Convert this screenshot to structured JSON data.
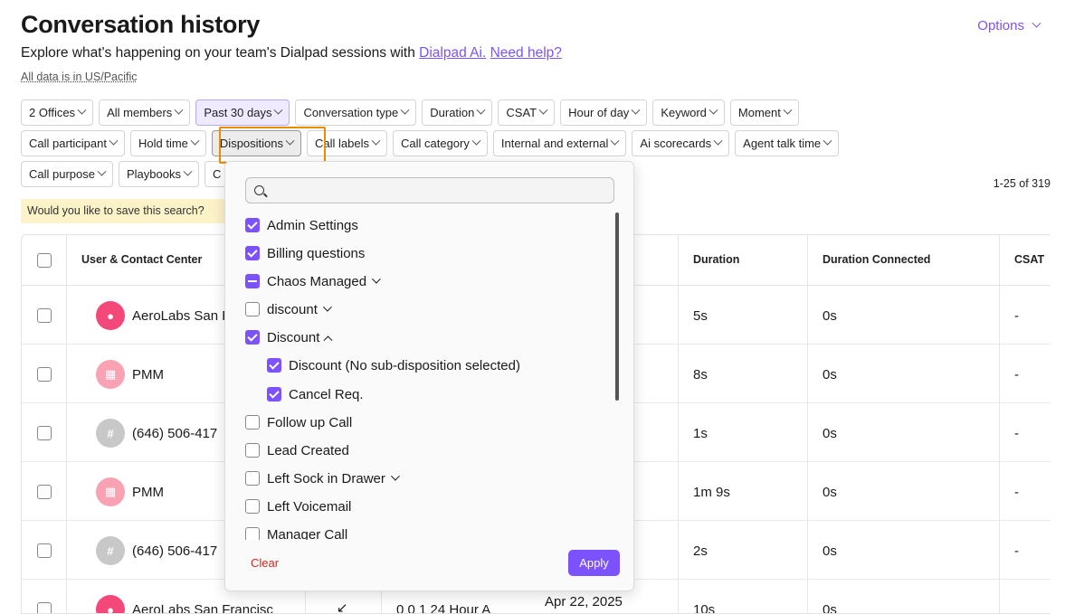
{
  "header": {
    "title": "Conversation history",
    "subtitle_text": "Explore what's happening on your team's Dialpad sessions with ",
    "subtitle_link1": "Dialpad Ai.",
    "subtitle_link2": "Need help?",
    "timezone_note": "All data is in US/Pacific",
    "options_label": "Options"
  },
  "filters": {
    "row1": [
      "2 Offices",
      "All members",
      "Past 30 days",
      "Conversation type",
      "Duration",
      "CSAT",
      "Hour of day",
      "Keyword",
      "Moment"
    ],
    "row2": [
      "Call participant",
      "Hold time",
      "Dispositions",
      "Call labels",
      "Call category",
      "Internal and external",
      "Ai scorecards",
      "Agent talk time"
    ],
    "row3": [
      "Call purpose",
      "Playbooks",
      "C"
    ]
  },
  "results_count": "1-25 of 319",
  "save_banner": "Would you like to save this search?",
  "table": {
    "headers": {
      "user": "User & Contact Center",
      "duration": "Duration",
      "duration_connected": "Duration Connected",
      "csat": "CSAT"
    },
    "rows": [
      {
        "name": "AeroLabs San Fr",
        "duration": "5s",
        "connected": "0s",
        "csat": "-"
      },
      {
        "name": "PMM",
        "duration": "8s",
        "connected": "0s",
        "csat": "-"
      },
      {
        "name": "(646) 506-417",
        "duration": "1s",
        "connected": "0s",
        "csat": "-"
      },
      {
        "name": "PMM",
        "duration": "1m 9s",
        "connected": "0s",
        "csat": "-"
      },
      {
        "name": "(646) 506-417",
        "duration": "2s",
        "connected": "0s",
        "csat": "-"
      },
      {
        "name": "AeroLabs San Francisc",
        "duration": "10s",
        "connected": "0s",
        "csat": "-",
        "time": "0 0 1 24 Hour A",
        "date": "Apr 22, 2025"
      }
    ]
  },
  "dropdown": {
    "search_placeholder": "",
    "items": [
      {
        "label": "Admin Settings",
        "state": "on"
      },
      {
        "label": "Billing questions",
        "state": "on"
      },
      {
        "label": "Chaos Managed",
        "state": "partial"
      },
      {
        "label": "discount",
        "state": "off"
      },
      {
        "label": "Discount",
        "state": "on"
      },
      {
        "label": "Discount (No sub-disposition selected)",
        "state": "on"
      },
      {
        "label": "Cancel Req.",
        "state": "on"
      },
      {
        "label": "Follow up Call",
        "state": "off"
      },
      {
        "label": "Lead Created",
        "state": "off"
      },
      {
        "label": "Left Sock in Drawer",
        "state": "off"
      },
      {
        "label": "Left Voicemail",
        "state": "off"
      },
      {
        "label": "Manager Call",
        "state": "off"
      }
    ],
    "clear_label": "Clear",
    "apply_label": "Apply"
  },
  "colors": {
    "accent": "#7c52ff",
    "highlight_box": "#f08a00",
    "clear_text": "#d9261c",
    "banner_bg": "#fdf3c8"
  }
}
